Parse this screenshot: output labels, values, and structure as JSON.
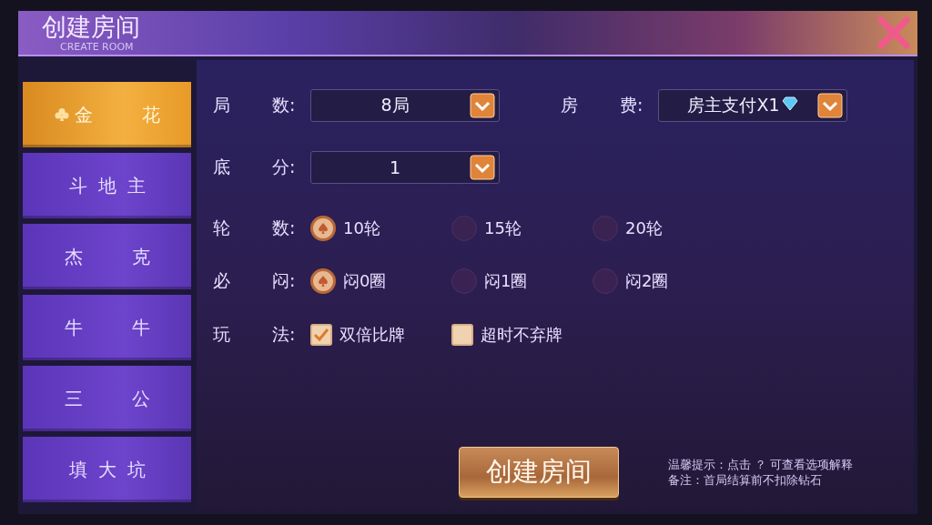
{
  "window": {
    "title": "创建房间",
    "subtitle": "CREATE ROOM"
  },
  "games": [
    {
      "label": "金花",
      "selected": true
    },
    {
      "label": "斗地主",
      "selected": false
    },
    {
      "label": "杰克",
      "selected": false
    },
    {
      "label": "牛牛",
      "selected": false
    },
    {
      "label": "三公",
      "selected": false
    },
    {
      "label": "填大坑",
      "selected": false
    }
  ],
  "selects": [
    {
      "label_1": "局",
      "label_2": "数:",
      "value": "8局"
    },
    {
      "label_1": "房",
      "label_2": "费:",
      "value": "房主支付X1"
    },
    {
      "label_1": "底",
      "label_2": "分:",
      "value": "1"
    }
  ],
  "radio_groups": [
    {
      "label_1": "轮",
      "label_2": "数:",
      "options": [
        {
          "label": "10轮",
          "selected": true
        },
        {
          "label": "15轮",
          "selected": false
        },
        {
          "label": "20轮",
          "selected": false
        }
      ]
    },
    {
      "label_1": "必",
      "label_2": "闷:",
      "options": [
        {
          "label": "闷0圈",
          "selected": true
        },
        {
          "label": "闷1圈",
          "selected": false
        },
        {
          "label": "闷2圈",
          "selected": false
        }
      ]
    }
  ],
  "rules": {
    "label_1": "玩",
    "label_2": "法:",
    "options": [
      {
        "label": "双倍比牌",
        "checked": true
      },
      {
        "label": "超时不弃牌",
        "checked": false
      }
    ]
  },
  "create_button": "创建房间",
  "notes": [
    "温馨提示：点击 ？  可查看选项解释",
    "备注：首局结算前不扣除钻石"
  ]
}
